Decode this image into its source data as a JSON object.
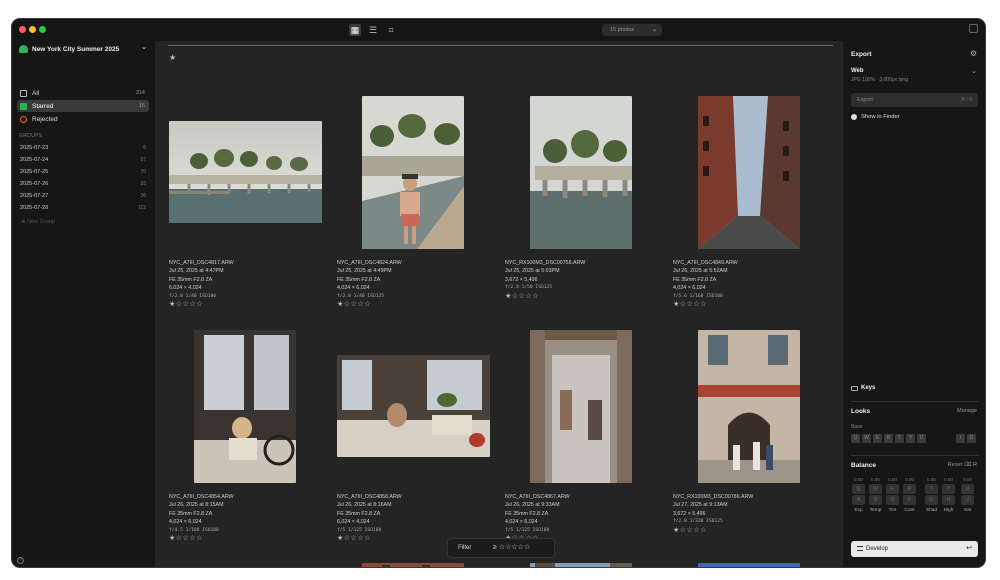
{
  "titlebar": {
    "photo_count": "15 photos"
  },
  "sidebar": {
    "library_name": "New York City Summer 2025",
    "items": [
      {
        "label": "All",
        "count": "314"
      },
      {
        "label": "Starred",
        "count": "15"
      },
      {
        "label": "Rejected",
        "count": ""
      }
    ],
    "groups_header": "GROUPS",
    "groups": [
      {
        "label": "2025-07-23",
        "count": "6"
      },
      {
        "label": "2025-07-24",
        "count": "57"
      },
      {
        "label": "2025-07-25",
        "count": "70"
      },
      {
        "label": "2025-07-26",
        "count": "33"
      },
      {
        "label": "2025-07-27",
        "count": "36"
      },
      {
        "label": "2025-07-28",
        "count": "112"
      }
    ],
    "new_group": "New Group"
  },
  "photos": [
    {
      "name": "NYC_A7III_DSC4817.ARW",
      "date": "Jul 25, 2025 at 4:47PM",
      "lens": "FE 35mm F2.8 ZA",
      "dims": "6,024 × 4,024",
      "exposure": "f/2.8 1/40 ISO100",
      "stars": "★☆☆☆☆"
    },
    {
      "name": "NYC_A7III_DSC4824.ARW",
      "date": "Jul 25, 2025 at 4:49PM",
      "lens": "FE 35mm F2.8 ZA",
      "dims": "4,024 × 6,024",
      "exposure": "f/2.8 1/40 ISO125",
      "stars": "★☆☆☆☆"
    },
    {
      "name": "NYC_RX100M3_DSC00758.ARW",
      "date": "Jul 25, 2025 at 5:03PM",
      "lens": "",
      "dims": "3,672 × 5,496",
      "exposure": "f/2.8 1/50 ISO125",
      "stars": "★☆☆☆☆"
    },
    {
      "name": "NYC_A7III_DSC4849.ARW",
      "date": "Jul 26, 2025 at 5:52AM",
      "lens": "FE 35mm F2.8 ZA",
      "dims": "4,024 × 6,024",
      "exposure": "f/5.6 1/160 ISO100",
      "stars": "★☆☆☆☆"
    },
    {
      "name": "NYC_A7III_DSC4854.ARW",
      "date": "Jul 26, 2025 at 8:15AM",
      "lens": "FE 35mm F2.8 ZA",
      "dims": "4,024 × 6,024",
      "exposure": "f/4.5 1/100 ISO100",
      "stars": "★☆☆☆☆"
    },
    {
      "name": "NYC_A7III_DSC4858.ARW",
      "date": "Jul 26, 2025 at 8:16AM",
      "lens": "FE 35mm F2.8 ZA",
      "dims": "6,024 × 4,024",
      "exposure": "f/5 1/125 ISO100",
      "stars": "★☆☆☆☆"
    },
    {
      "name": "NYC_A7III_DSC4867.ARW",
      "date": "Jul 26, 2025 at 9:33AM",
      "lens": "FE 35mm F2.8 ZA",
      "dims": "4,024 × 6,024",
      "exposure": "f/5 1/125 ISO100",
      "stars": "★☆☆☆☆"
    },
    {
      "name": "NYC_RX100M3_DSC00786.ARW",
      "date": "Jul 27, 2025 at 9:13AM",
      "lens": "",
      "dims": "3,672 × 5,496",
      "exposure": "f/2.8 1/320 ISO125",
      "stars": "★☆☆☆☆"
    }
  ],
  "filter": {
    "label": "Filter",
    "symbol": "≥",
    "stars": "☆☆☆☆☆"
  },
  "right_panel": {
    "export_title": "Export",
    "preset": "Web",
    "preset_desc": "JPG 100% · 3,000px long",
    "export_button": "Export",
    "export_kbd": "⌘⇧E",
    "show_in_finder": "Show in Finder",
    "keys": "Keys",
    "looks_title": "Looks",
    "manage": "Manage",
    "base": "Base",
    "look_keys": [
      "Q",
      "W",
      "E",
      "R",
      "T",
      "Y",
      "U"
    ],
    "look_keys_right": [
      "I",
      "O"
    ],
    "balance_title": "Balance",
    "reset": "Reset",
    "reset_kbd": "R",
    "balance": [
      {
        "label": "Exp",
        "value": "0.00",
        "k1": "Q",
        "k2": "A"
      },
      {
        "label": "Temp",
        "value": "0.00",
        "k1": "W",
        "k2": "S"
      },
      {
        "label": "Tint",
        "value": "0.00",
        "k1": "E",
        "k2": "D"
      },
      {
        "label": "Cont",
        "value": "0.00",
        "k1": "R",
        "k2": "F"
      },
      {
        "label": "Shad",
        "value": "0.00",
        "k1": "T",
        "k2": "G"
      },
      {
        "label": "High",
        "value": "0.00",
        "k1": "Y",
        "k2": "H"
      },
      {
        "label": "Sat",
        "value": "0.00",
        "k1": "U",
        "k2": "J"
      }
    ],
    "develop": "Develop"
  }
}
